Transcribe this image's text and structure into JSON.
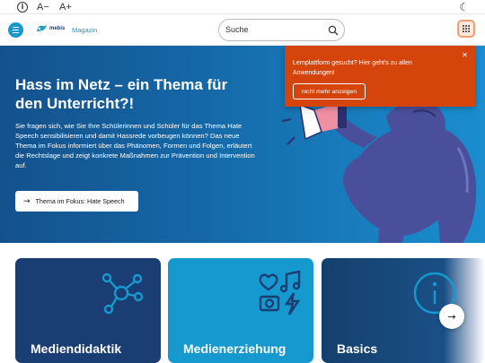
{
  "utility_bar": {
    "info_icon": "info-circle-icon",
    "font_decrease": "A−",
    "font_increase": "A+",
    "theme_icon": "moon-icon"
  },
  "header": {
    "logo_text": "mebis",
    "section_label": "Magazin",
    "search_placeholder": "Suche",
    "menu_icon": "hamburger-icon",
    "apps_icon": "grid-icon",
    "brand_color": "#1699cf"
  },
  "hero": {
    "title": "Hass im Netz – ein Thema für den Unterricht?!",
    "text": "Sie fragen sich, wie Sie Ihre Schülerinnen und Schüler für das Thema Hate Speech sensibilisieren und damit Hassrede vorbeugen können? Das neue Thema im Fokus informiert über das Phänomen, Formen und Folgen, erläutert die Rechtslage und zeigt konkrete Maßnahmen zur Prävention und Intervention auf.",
    "cta_label": "Thema im Fokus: Hate Speech",
    "background_color": "#1567a6",
    "illustration_color": "#4a4f9c"
  },
  "toast": {
    "message": "Lernplattform gesucht? Hier geht's zu allen Anwendungen!",
    "button_label": "nicht mehr anzeigen",
    "close_icon": "close-icon",
    "color": "#d5440b"
  },
  "cards": [
    {
      "title": "Mediendidaktik",
      "icon": "network-nodes-icon",
      "color": "#1a3e73"
    },
    {
      "title": "Medienerziehung",
      "icon": "media-collage-icon",
      "color": "#1699cf"
    },
    {
      "title": "Basics",
      "icon": "info-circle-icon",
      "color": "#14406c"
    }
  ],
  "carousel": {
    "next_icon": "arrow-right-icon"
  }
}
